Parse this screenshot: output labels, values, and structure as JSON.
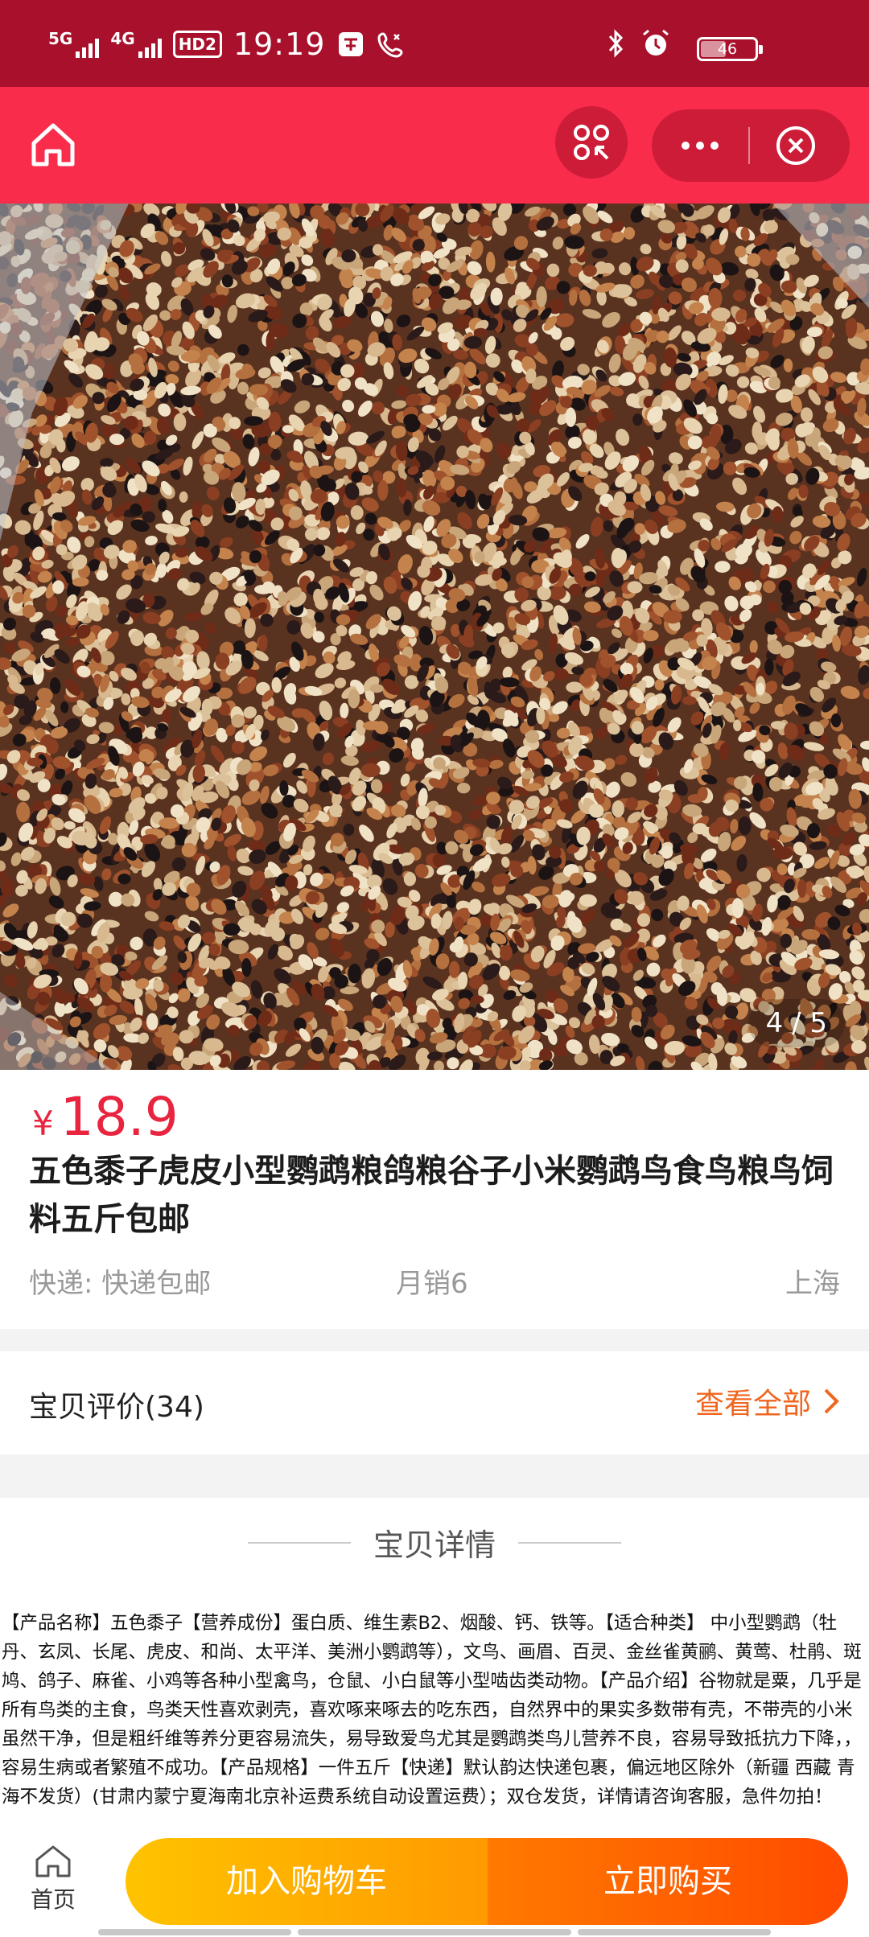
{
  "status_bar": {
    "network_1": "5G",
    "network_2": "4G",
    "hd_label": "HD2",
    "time": "19:19",
    "battery": "46",
    "battery_level": 0.46
  },
  "navbar": {
    "home_icon": "home-icon",
    "scan_icon": "scan-icon",
    "more_icon": "more-icon",
    "close_icon": "close-icon"
  },
  "gallery": {
    "counter": "4 / 5",
    "current": 4,
    "total": 5
  },
  "product": {
    "currency": "¥",
    "price": "18.9",
    "title": "五色黍子虎皮小型鹦鹉粮鸽粮谷子小米鹦鹉鸟食鸟粮鸟饲料五斤包邮",
    "shipping": "快递: 快递包邮",
    "monthly_sales": "月销6",
    "location": "上海"
  },
  "reviews": {
    "title": "宝贝评价(34)",
    "view_all": "查看全部"
  },
  "details": {
    "header": "宝贝详情",
    "text": "【产品名称】五色黍子【营养成份】蛋白质、维生素B2、烟酸、钙、铁等。【适合种类】 中小型鹦鹉（牡丹、玄凤、长尾、虎皮、和尚、太平洋、美洲小鹦鹉等），文鸟、画眉、百灵、金丝雀黄鹂、黄莺、杜鹃、斑鸠、鸽子、麻雀、小鸡等各种小型禽鸟，仓鼠、小白鼠等小型啮齿类动物。【产品介绍】谷物就是粟，几乎是所有鸟类的主食，鸟类天性喜欢剥壳，喜欢啄来啄去的吃东西，自然界中的果实多数带有壳，不带壳的小米虽然干净，但是粗纤维等养分更容易流失，易导致爱鸟尤其是鹦鹉类鸟儿营养不良，容易导致抵抗力下降，，容易生病或者繁殖不成功。【产品规格】一件五斤【快递】默认韵达快递包裹，偏远地区除外（新疆 西藏 青海不发货）(甘肃内蒙宁夏海南北京补运费系统自动设置运费）；双仓发货，详情请咨询客服，急件勿拍！"
  },
  "bottom_bar": {
    "home_label": "首页",
    "add_to_cart": "加入购物车",
    "buy_now": "立即购买"
  },
  "colors": {
    "status_bar": "#a8102b",
    "navbar": "#fa2c4c",
    "price": "#e8243f",
    "link": "#f0661e",
    "cart_button": "#ffb000",
    "buy_button": "#ff5a00"
  }
}
